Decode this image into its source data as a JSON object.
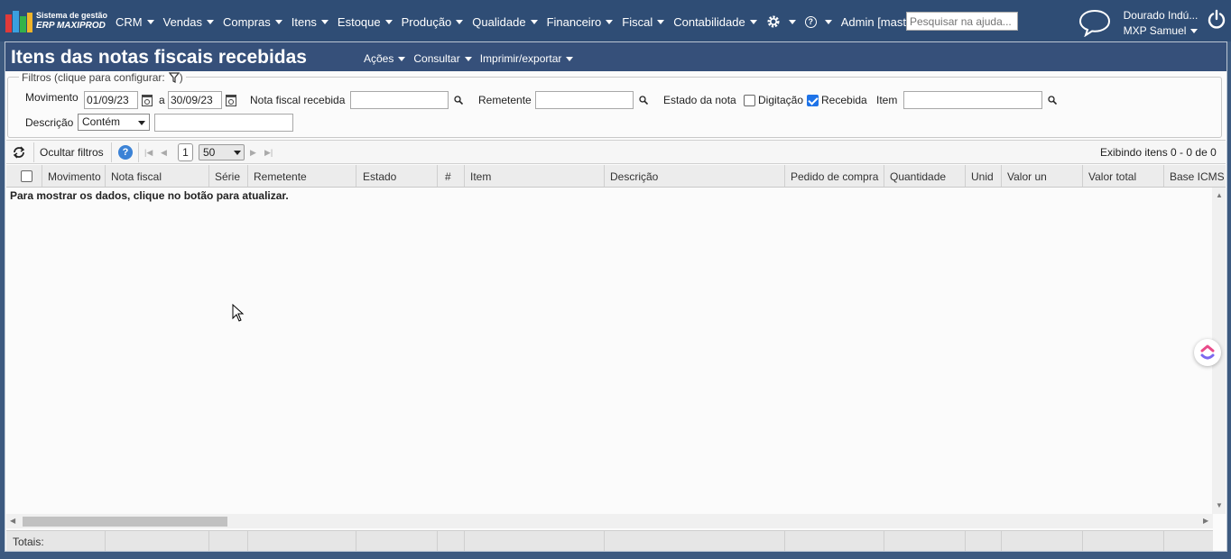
{
  "app": {
    "logo_line1": "Sistema de gestão",
    "logo_line2": "ERP MAXIPROD"
  },
  "nav": {
    "items": [
      {
        "label": "CRM"
      },
      {
        "label": "Vendas"
      },
      {
        "label": "Compras"
      },
      {
        "label": "Itens"
      },
      {
        "label": "Estoque"
      },
      {
        "label": "Produção"
      },
      {
        "label": "Qualidade"
      },
      {
        "label": "Financeiro"
      },
      {
        "label": "Fiscal"
      },
      {
        "label": "Contabilidade"
      }
    ],
    "settings_icon": "gear-icon",
    "help_icon": "help-icon",
    "help_glyph": "?",
    "admin_label": "Admin [master]",
    "search_placeholder": "Pesquisar na ajuda...",
    "company": "Dourado Indú...",
    "user": "MXP Samuel"
  },
  "page": {
    "title": "Itens das notas fiscais recebidas",
    "menus": [
      "Ações",
      "Consultar",
      "Imprimir/exportar"
    ]
  },
  "filters": {
    "legend": "Filtros (clique para configurar:",
    "legend_close": ")",
    "movimento_label": "Movimento",
    "date_from": "01/09/23",
    "date_sep": "a",
    "date_to": "30/09/23",
    "nota_label": "Nota fiscal recebida",
    "nota_value": "",
    "remetente_label": "Remetente",
    "remetente_value": "",
    "estado_label": "Estado da nota",
    "digitacao_label": "Digitação",
    "digitacao_checked": false,
    "recebida_label": "Recebida",
    "recebida_checked": true,
    "item_label": "Item",
    "item_value": "",
    "descricao_label": "Descrição",
    "descricao_mode": "Contém",
    "descricao_value": ""
  },
  "toolbar": {
    "hide_filters": "Ocultar filtros",
    "help_glyph": "?",
    "page": "1",
    "page_size": "50",
    "status": "Exibindo itens 0 - 0 de 0"
  },
  "grid": {
    "columns": [
      "Movimento",
      "Nota fiscal",
      "Série",
      "Remetente",
      "Estado",
      "#",
      "Item",
      "Descrição",
      "Pedido de compra",
      "Quantidade",
      "Unid",
      "Valor un",
      "Valor total",
      "Base ICMS"
    ],
    "empty_message": "Para mostrar os dados, clique no botão para atualizar.",
    "totals_label": "Totais:"
  },
  "colors": {
    "nav_bg": "#2f4d75",
    "title_bg": "#36507a",
    "checkbox_checked": "#1e73e8"
  }
}
